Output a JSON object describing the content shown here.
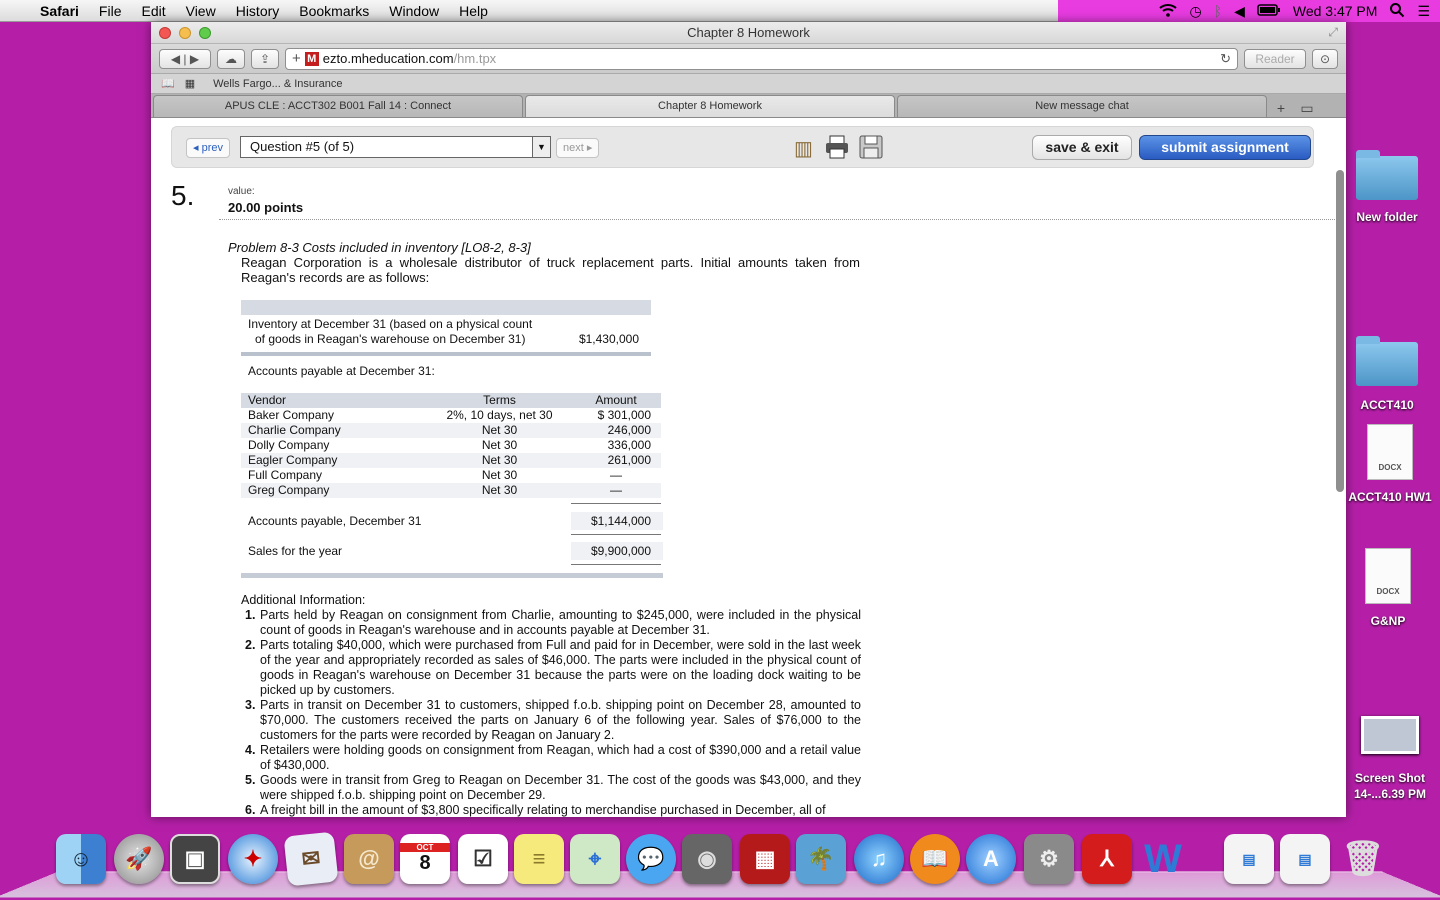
{
  "menubar": {
    "apple_glyph": "",
    "app_name": "Safari",
    "menus": [
      "File",
      "Edit",
      "View",
      "History",
      "Bookmarks",
      "Window",
      "Help"
    ],
    "clock": "Wed 3:47 PM"
  },
  "window": {
    "title": "Chapter 8 Homework",
    "url_domain": "ezto.mheducation.com",
    "url_path": "/hm.tpx",
    "reader_label": "Reader",
    "bookmark": "Wells Fargo... & Insurance",
    "tabs": [
      "APUS CLE : ACCT302 B001 Fall 14 : Connect",
      "Chapter 8 Homework",
      "New message chat"
    ]
  },
  "question_nav": {
    "prev_label": "prev",
    "select_value": "Question #5 (of 5)",
    "next_label": "next",
    "save_label": "save & exit",
    "submit_label": "submit assignment"
  },
  "question": {
    "number": "5.",
    "value_label": "value:",
    "points": "20.00 points",
    "title": "Problem 8-3 Costs included in inventory [LO8-2, 8-3]",
    "intro": "Reagan Corporation is a wholesale distributor of truck replacement parts. Initial amounts taken from Reagan's records are as follows:",
    "inventory_line1": "Inventory at December 31 (based on a physical count",
    "inventory_line2": "of goods in Reagan's warehouse on December 31)",
    "inventory_value": "$1,430,000",
    "ap_label": "Accounts payable at December 31:",
    "vendor_headers": [
      "Vendor",
      "Terms",
      "Amount"
    ],
    "vendors": [
      {
        "vendor": "Baker Company",
        "terms": "2%, 10 days, net 30",
        "amount": "$  301,000"
      },
      {
        "vendor": "Charlie Company",
        "terms": "Net 30",
        "amount": "246,000"
      },
      {
        "vendor": "Dolly Company",
        "terms": "Net 30",
        "amount": "336,000"
      },
      {
        "vendor": "Eagler Company",
        "terms": "Net 30",
        "amount": "261,000"
      },
      {
        "vendor": "Full Company",
        "terms": "Net 30",
        "amount": "—"
      },
      {
        "vendor": "Greg Company",
        "terms": "Net 30",
        "amount": "—"
      }
    ],
    "ap_total_label": "Accounts payable, December 31",
    "ap_total": "$1,144,000",
    "sales_label": "Sales for the year",
    "sales_value": "$9,900,000",
    "additional_title": "Additional Information:",
    "additional": [
      {
        "n": "1.",
        "text": "Parts held by Reagan on consignment from Charlie, amounting to $245,000, were included in the physical count of goods in Reagan's warehouse and in accounts payable at December 31."
      },
      {
        "n": "2.",
        "text": "Parts totaling $40,000, which were purchased from Full and paid for in December, were sold in the last week of the year and appropriately recorded as sales of $46,000. The parts were included in the physical count of goods in Reagan's warehouse on December 31 because the parts were on the loading dock waiting to be picked up by customers."
      },
      {
        "n": "3.",
        "text": "Parts in transit on December 31 to customers, shipped f.o.b. shipping point on December 28, amounted to $70,000. The customers received the parts on January 6 of the following year. Sales of $76,000 to the customers for the parts were recorded by Reagan on January 2."
      },
      {
        "n": "4.",
        "text": "Retailers were holding goods on consignment from Reagan, which had a cost of $390,000 and a retail value of $430,000."
      },
      {
        "n": "5.",
        "text": "Goods were in transit from Greg to Reagan on December 31. The cost of the goods was $43,000, and they were shipped f.o.b. shipping point on December 29."
      },
      {
        "n": "6.",
        "text": "A freight bill in the amount of $3,800 specifically relating to merchandise purchased in December, all of"
      }
    ]
  },
  "desktop": {
    "icons": [
      {
        "label": "New folder",
        "type": "folder"
      },
      {
        "label": "ACCT410",
        "type": "folder"
      },
      {
        "label": "ACCT410 HW1",
        "type": "docx",
        "badge": "DOCX"
      },
      {
        "label": "G&NP",
        "type": "docx",
        "badge": "DOCX"
      },
      {
        "label": "Screen Shot\n14-...6.39 PM",
        "type": "image"
      }
    ]
  },
  "dock": {
    "calendar_month": "OCT",
    "calendar_day": "8",
    "apps": [
      "finder",
      "launchpad",
      "photo-booth",
      "safari",
      "mail",
      "contacts",
      "calendar",
      "reminders",
      "notes",
      "maps",
      "messages",
      "facetime",
      "photo-booth-curtain",
      "iphoto",
      "itunes",
      "ibooks",
      "app-store",
      "system-preferences",
      "acrobat",
      "word",
      "document",
      "document",
      "trash"
    ]
  },
  "colors": {
    "desktop": "#b51fa8",
    "menubar_right": "#e83be0",
    "submit": "#2a5bc2"
  }
}
